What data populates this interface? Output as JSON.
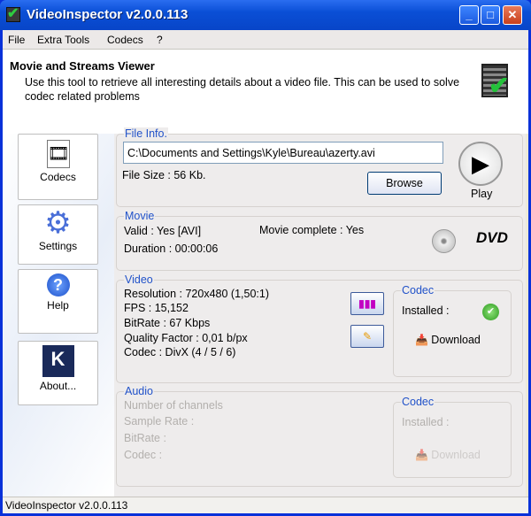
{
  "window": {
    "title": "VideoInspector v2.0.0.113"
  },
  "menu": [
    "File",
    "Extra Tools",
    "Codecs",
    "?"
  ],
  "header": {
    "title": "Movie and Streams Viewer",
    "description": "Use this tool to retrieve all interesting details about a video file. This can be used to solve codec related problems"
  },
  "sidebar": [
    {
      "label": "Codecs",
      "icon": "codecs-icon"
    },
    {
      "label": "Settings",
      "icon": "gear-icon"
    },
    {
      "label": "Help",
      "icon": "help-icon"
    },
    {
      "label": "About...",
      "icon": "about-icon"
    }
  ],
  "file_info": {
    "label": "File Info.",
    "path": "C:\\Documents and Settings\\Kyle\\Bureau\\azerty.avi",
    "size": "File Size : 56 Kb.",
    "browse": "Browse",
    "play": "Play"
  },
  "movie": {
    "label": "Movie",
    "valid": "Valid : Yes [AVI]",
    "duration": "Duration : 00:00:06",
    "complete": "Movie complete : Yes",
    "dvd": "DVD"
  },
  "video": {
    "label": "Video",
    "lines": [
      "Resolution : 720x480 (1,50:1)",
      "FPS : 15,152",
      "BitRate : 67 Kbps",
      "Quality Factor : 0,01 b/px",
      "Codec : DivX (4 / 5 / 6)"
    ],
    "codec": {
      "label": "Codec",
      "installed": "Installed :",
      "download": "Download"
    }
  },
  "audio": {
    "label": "Audio",
    "lines": [
      "Number of channels",
      "Sample Rate :",
      "BitRate :",
      "Codec :"
    ],
    "codec": {
      "label": "Codec",
      "installed": "Installed :",
      "download": "Download"
    }
  },
  "status": "VideoInspector v2.0.0.113"
}
